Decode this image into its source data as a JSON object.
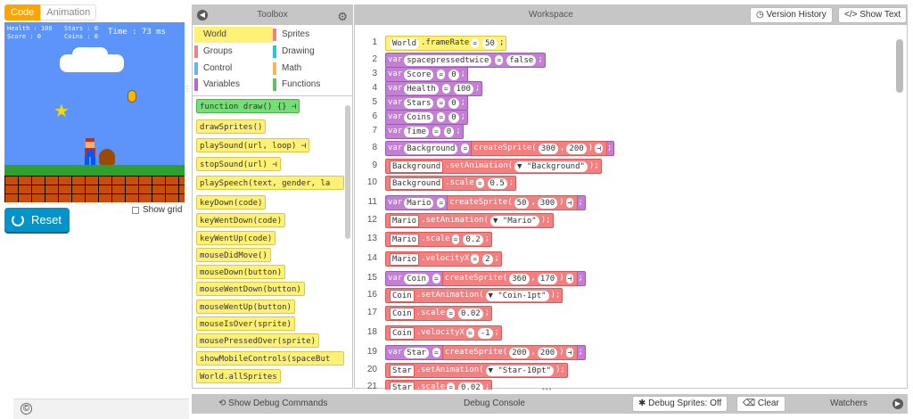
{
  "mode_tabs": {
    "code": "Code",
    "animation": "Animation"
  },
  "game": {
    "hud": {
      "health": "Health : 100",
      "score": "Score : 0",
      "stars": "Stars : 0",
      "coins": "Coins : 0",
      "time": "Time : 73 ms"
    }
  },
  "reset_label": "Reset",
  "show_grid_label": "Show grid",
  "copyright": "©",
  "toolbox": {
    "title": "Toolbox",
    "categories": [
      {
        "label": "World",
        "color": "#fff176"
      },
      {
        "label": "Sprites",
        "color": "#f28080"
      },
      {
        "label": "Groups",
        "color": "#f28080"
      },
      {
        "label": "Drawing",
        "color": "#26c6da"
      },
      {
        "label": "Control",
        "color": "#64b5f6"
      },
      {
        "label": "Math",
        "color": "#ffb74d"
      },
      {
        "label": "Variables",
        "color": "#ba68c8"
      },
      {
        "label": "Functions",
        "color": "#66bb6a"
      }
    ],
    "blocks": [
      "function draw() {} ⊣",
      "drawSprites()",
      "playSound(url, loop) ⊣",
      "stopSound(url) ⊣",
      "playSpeech(text, gender, la",
      "keyDown(code)",
      "keyWentDown(code)",
      "keyWentUp(code)",
      "mouseDidMove()",
      "mouseDown(button)",
      "mouseWentDown(button)",
      "mouseWentUp(button)",
      "mouseIsOver(sprite)",
      "mousePressedOver(sprite)",
      "showMobileControls(spaceBut",
      "World.allSprites"
    ]
  },
  "workspace": {
    "title": "Workspace",
    "version_history": "Version History",
    "show_text": "Show Text",
    "line_numbers": [
      "1",
      "2",
      "3",
      "4",
      "5",
      "6",
      "7",
      "8",
      "9",
      "10",
      "11",
      "12",
      "13",
      "14",
      "15",
      "16",
      "17",
      "18",
      "19",
      "20",
      "21"
    ],
    "lines": {
      "l1": {
        "obj": "World",
        "prop": ".frameRate",
        "eq": "=",
        "val": "50"
      },
      "l2": {
        "kw": "var",
        "name": "spacepressedtwice",
        "eq": "=",
        "val": "false"
      },
      "l3": {
        "kw": "var",
        "name": "Score",
        "eq": "=",
        "val": "0"
      },
      "l4": {
        "kw": "var",
        "name": "Health",
        "eq": "=",
        "val": "100"
      },
      "l5": {
        "kw": "var",
        "name": "Stars",
        "eq": "=",
        "val": "0"
      },
      "l6": {
        "kw": "var",
        "name": "Coins",
        "eq": "=",
        "val": "0"
      },
      "l7": {
        "kw": "var",
        "name": "Time",
        "eq": "=",
        "val": "0"
      },
      "l8": {
        "kw": "var",
        "name": "Background",
        "eq": "=",
        "fn": "createSprite(",
        "a1": "300",
        "a2": "200",
        "close": ")"
      },
      "l9": {
        "obj": "Background",
        "method": ".setAnimation(",
        "arg": "▼ \"Background\"",
        "close": ");"
      },
      "l10": {
        "obj": "Background",
        "prop": ".scale",
        "eq": "=",
        "val": "0.5"
      },
      "l11": {
        "kw": "var",
        "name": "Mario",
        "eq": "=",
        "fn": "createSprite(",
        "a1": "50",
        "a2": "300",
        "close": ")"
      },
      "l12": {
        "obj": "Mario",
        "method": ".setAnimation(",
        "arg": "▼ \"Mario\"",
        "close": ");"
      },
      "l13": {
        "obj": "Mario",
        "prop": ".scale",
        "eq": "=",
        "val": "0.2"
      },
      "l14": {
        "obj": "Mario",
        "prop": ".velocityX",
        "eq": "=",
        "val": "2"
      },
      "l15": {
        "kw": "var",
        "name": "Coin",
        "eq": "=",
        "fn": "createSprite(",
        "a1": "360",
        "a2": "170",
        "close": ")"
      },
      "l16": {
        "obj": "Coin",
        "method": ".setAnimation(",
        "arg": "▼ \"Coin-1pt\"",
        "close": ");"
      },
      "l17": {
        "obj": "Coin",
        "prop": ".scale",
        "eq": "=",
        "val": "0.02"
      },
      "l18": {
        "obj": "Coin",
        "prop": ".velocityX",
        "eq": "=",
        "val": "-1"
      },
      "l19": {
        "kw": "var",
        "name": "Star",
        "eq": "=",
        "fn": "createSprite(",
        "a1": "200",
        "a2": "200",
        "close": ")"
      },
      "l20": {
        "obj": "Star",
        "method": ".setAnimation(",
        "arg": "▼ \"Star-10pt\"",
        "close": ");"
      },
      "l21": {
        "obj": "Star",
        "prop": ".scale",
        "eq": "=",
        "val": "0.02"
      }
    }
  },
  "bottom": {
    "show_debug": "Show Debug Commands",
    "debug_console": "Debug Console",
    "debug_sprites": "Debug Sprites: Off",
    "clear": "Clear",
    "watchers": "Watchers"
  }
}
